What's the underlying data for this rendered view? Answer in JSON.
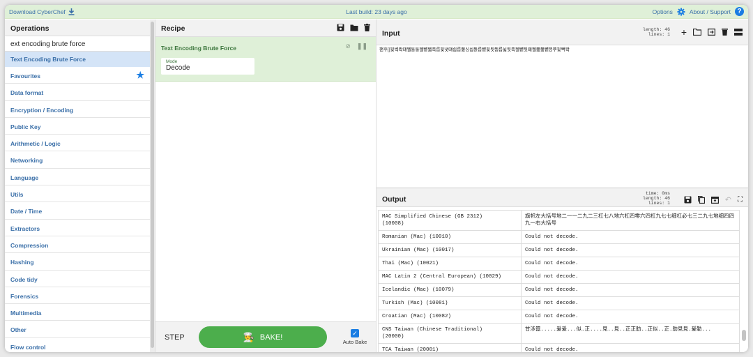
{
  "banner": {
    "download": "Download CyberChef",
    "build": "Last build: 23 days ago",
    "options": "Options",
    "about": "About / Support"
  },
  "operations": {
    "title": "Operations",
    "search_value": "ext encoding brute force",
    "active_op": "Text Encoding Brute Force",
    "categories": [
      "Favourites",
      "Data format",
      "Encryption / Encoding",
      "Public Key",
      "Arithmetic / Logic",
      "Networking",
      "Language",
      "Utils",
      "Date / Time",
      "Extractors",
      "Compression",
      "Hashing",
      "Code tidy",
      "Forensics",
      "Multimedia",
      "Other",
      "Flow control"
    ]
  },
  "recipe": {
    "title": "Recipe",
    "op_name": "Text Encoding Brute Force",
    "mode_label": "Mode",
    "mode_value": "Decode",
    "step": "STEP",
    "bake": "BAKE!",
    "auto_bake": "Auto Bake"
  },
  "input": {
    "title": "Input",
    "meta": "length: 46\nlines: 1",
    "text": "팬후[]뒻벡뫅떄쩰툥퉁쩰뻍쩳죽릅뒻냋떄쉽릅쭖싱쉽뚅릅뻍뒻뒷쮬릅뉣뒷죽쩰뻍뒷떄쩰쭖쭖뻍뜽뿌뒻뻑뫅"
  },
  "output": {
    "title": "Output",
    "meta": "time: 0ms\nlength: 46\nlines: 1",
    "rows": [
      {
        "enc": "MAC Simplified Chinese (GB 2312)\n(10008)",
        "res": "旗帜左大括号地二一一二九二三杠七八地六杠四零六四杠九七七细杠必七三二九七地细四四九一右大括号"
      },
      {
        "enc": "Romanian (Mac) (10010)",
        "res": "Could not decode."
      },
      {
        "enc": "Ukrainian (Mac) (10017)",
        "res": "Could not decode."
      },
      {
        "enc": "Thai (Mac) (10021)",
        "res": "Could not decode."
      },
      {
        "enc": "MAC Latin 2 (Central European) (10029)",
        "res": "Could not decode."
      },
      {
        "enc": "Icelandic (Mac) (10079)",
        "res": "Could not decode."
      },
      {
        "enc": "Turkish (Mac) (10081)",
        "res": "Could not decode."
      },
      {
        "enc": "Croatian (Mac) (10082)",
        "res": "Could not decode."
      },
      {
        "enc": "CNS Taiwan (Chinese Traditional)\n(20000)",
        "res": "甘涉囂.....爰爰...似.正....見..見..正正肪..正似..正.肪見見.爰勒..."
      },
      {
        "enc": "TCA Taiwan (20001)",
        "res": "Could not decode."
      }
    ]
  }
}
